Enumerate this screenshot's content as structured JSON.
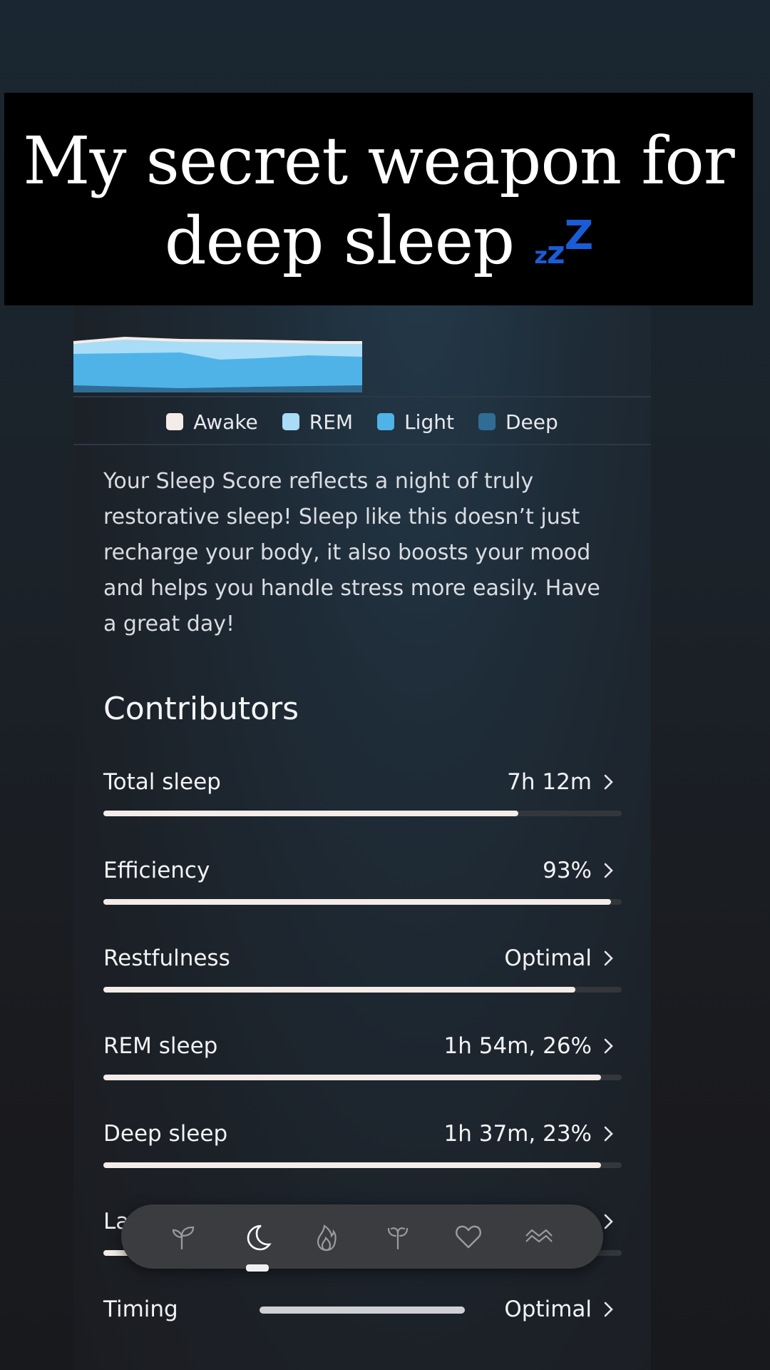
{
  "overlay": {
    "line1": "My secret weapon for",
    "line2": "deep sleep",
    "emoji": "zzz"
  },
  "legend": [
    {
      "label": "Awake",
      "color": "#f3ece8"
    },
    {
      "label": "REM",
      "color": "#a9dcf6"
    },
    {
      "label": "Light",
      "color": "#4fb3e8"
    },
    {
      "label": "Deep",
      "color": "#2f6d95"
    }
  ],
  "summary": "Your Sleep Score reflects a night of truly restorative sleep! Sleep like this doesn’t just recharge your body, it also boosts your mood and helps you handle stress more easily. Have a great day!",
  "contributors": {
    "title": "Contributors",
    "items": [
      {
        "label": "Total sleep",
        "value": "7h 12m",
        "level": 0.8
      },
      {
        "label": "Efficiency",
        "value": "93%",
        "level": 0.98
      },
      {
        "label": "Restfulness",
        "value": "Optimal",
        "level": 0.91
      },
      {
        "label": "REM sleep",
        "value": "1h 54m, 26%",
        "level": 0.96
      },
      {
        "label": "Deep sleep",
        "value": "1h 37m, 23%",
        "level": 0.96
      },
      {
        "label": "La",
        "value": "",
        "level": 0.95
      },
      {
        "label": "Timing",
        "value": "Optimal",
        "level": 0
      }
    ]
  },
  "nav": {
    "icons": [
      "sprout-icon",
      "moon-icon",
      "flame-icon",
      "plant-icon",
      "heart-icon",
      "waves-icon"
    ],
    "active": "moon-icon"
  },
  "colors": {
    "awake": "#f3ece8",
    "rem": "#a9dcf6",
    "light": "#4fb3e8",
    "deep": "#2f6d95",
    "emoji": "#1a5cd6"
  }
}
